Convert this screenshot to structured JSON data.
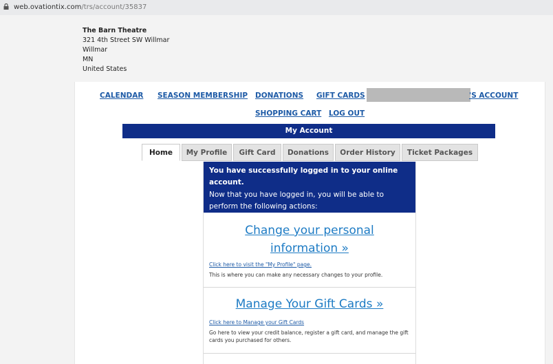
{
  "browser": {
    "url_host": "web.ovationtix.com",
    "url_path": "/trs/account/35837"
  },
  "venue": {
    "name": "The Barn Theatre",
    "street": "321 4th Street SW Willmar",
    "city": "Willmar",
    "state": "MN",
    "country": "United States"
  },
  "nav": {
    "calendar": "CALENDAR",
    "season_membership": "SEASON MEMBERSHIP",
    "donations": "DONATIONS",
    "gift_cards": "GIFT CARDS",
    "account_suffix": "'S ACCOUNT",
    "shopping_cart": "SHOPPING CART",
    "log_out": "LOG OUT"
  },
  "account_bar": "My Account",
  "tabs": [
    {
      "label": "Home",
      "active": true
    },
    {
      "label": "My Profile"
    },
    {
      "label": "Gift Card"
    },
    {
      "label": "Donations"
    },
    {
      "label": "Order History"
    },
    {
      "label": "Ticket Packages"
    }
  ],
  "notice": {
    "bold": "You have successfully logged in to your online account.",
    "sub": "Now that you have logged in, you will be able to perform the following actions:"
  },
  "sections": [
    {
      "title": "Change your personal information »",
      "link": "Click here to visit the \"My Profile\" page.",
      "desc": "This is where you can make any necessary changes to your profile."
    },
    {
      "title": "Manage Your Gift Cards »",
      "link": "Click here to Manage your Gift Cards",
      "desc": "Go here to view your credit balance, register a gift card, and manage the gift cards you purchased for others."
    }
  ],
  "colors": {
    "navy": "#0f2d88",
    "link": "#1d5aa6",
    "title_link": "#1d7bc4"
  }
}
